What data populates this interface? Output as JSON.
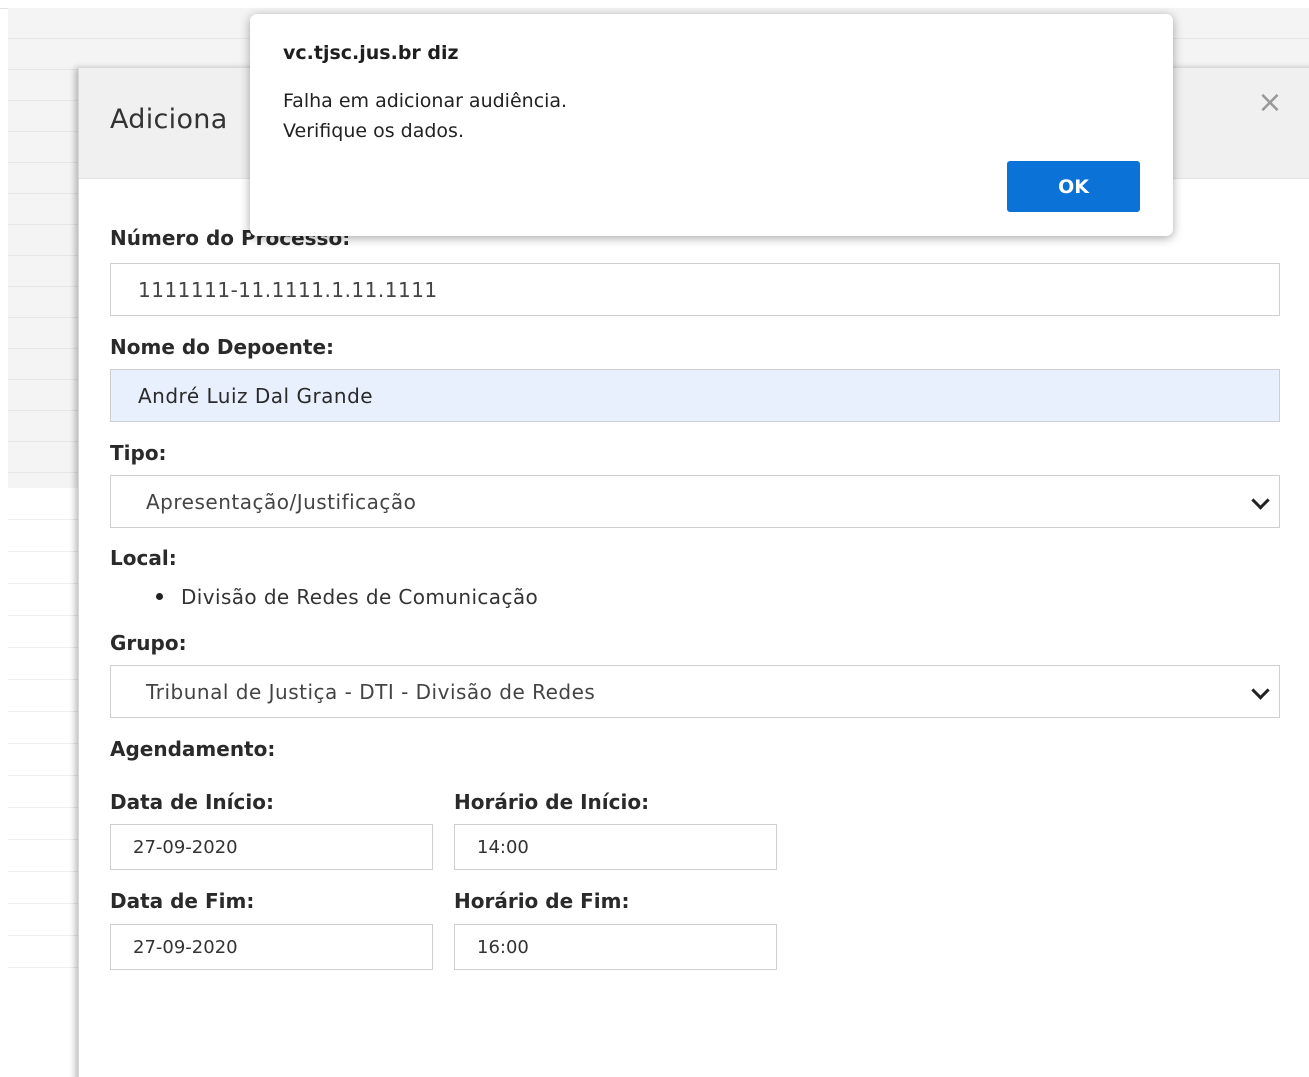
{
  "alert": {
    "origin": "vc.tjsc.jus.br diz",
    "message_line1": "Falha em adicionar audiência.",
    "message_line2": "Verifique os dados.",
    "ok_label": "OK"
  },
  "modal": {
    "title": "Adiciona",
    "close_label": "×"
  },
  "form": {
    "processo_label": "Número do Processo:",
    "processo_value": "1111111-11.1111.1.11.1111",
    "depoente_label": "Nome do Depoente:",
    "depoente_value": "André Luiz Dal Grande",
    "tipo_label": "Tipo:",
    "tipo_value": "Apresentação/Justificação",
    "local_label": "Local:",
    "local_items": [
      "Divisão de Redes de Comunicação"
    ],
    "grupo_label": "Grupo:",
    "grupo_value": "Tribunal de Justiça - DTI - Divisão de Redes",
    "agendamento_label": "Agendamento:",
    "data_inicio_label": "Data de Início:",
    "data_inicio_value": "27-09-2020",
    "horario_inicio_label": "Horário de Início:",
    "horario_inicio_value": "14:00",
    "data_fim_label": "Data de Fim:",
    "data_fim_value": "27-09-2020",
    "horario_fim_label": "Horário de Fim:",
    "horario_fim_value": "16:00"
  }
}
